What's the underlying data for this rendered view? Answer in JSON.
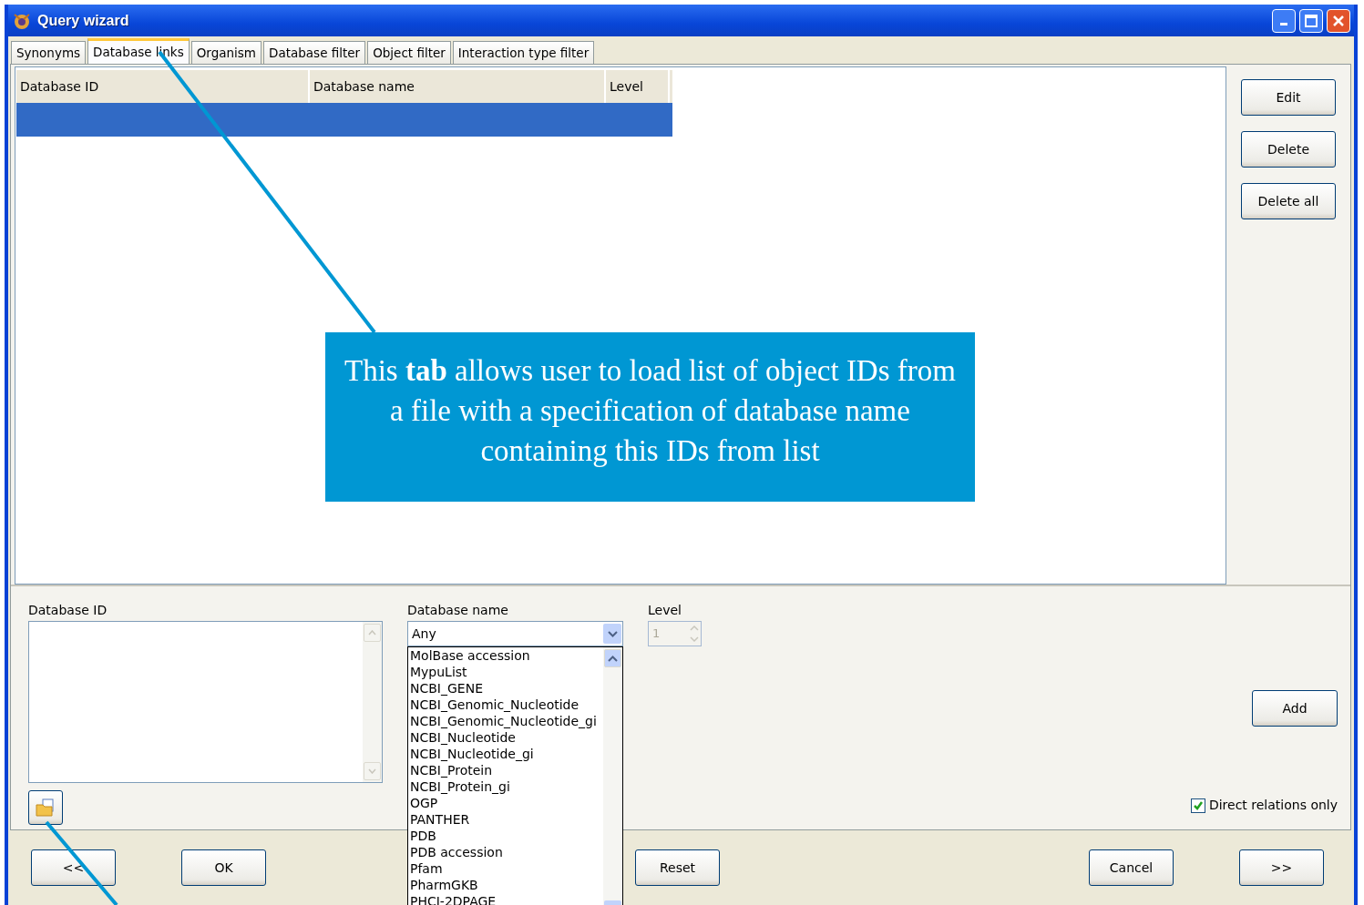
{
  "window": {
    "title": "Query wizard"
  },
  "tabs": [
    {
      "label": "Synonyms",
      "selected": false
    },
    {
      "label": "Database links",
      "selected": true
    },
    {
      "label": "Organism",
      "selected": false
    },
    {
      "label": "Database filter",
      "selected": false
    },
    {
      "label": "Object filter",
      "selected": false
    },
    {
      "label": "Interaction type filter",
      "selected": false
    }
  ],
  "table": {
    "columns": [
      "Database ID",
      "Database name",
      "Level"
    ],
    "rows": [
      {
        "selected": true
      }
    ]
  },
  "side_buttons": [
    "Edit",
    "Delete",
    "Delete all"
  ],
  "form": {
    "database_id": {
      "label": "Database ID"
    },
    "database_name": {
      "label": "Database name",
      "value": "Any",
      "expanded": true,
      "options": [
        "MolBase accession",
        "MypuList",
        "NCBI_GENE",
        "NCBI_Genomic_Nucleotide",
        "NCBI_Genomic_Nucleotide_gi",
        "NCBI_Nucleotide",
        "NCBI_Nucleotide_gi",
        "NCBI_Protein",
        "NCBI_Protein_gi",
        "OGP",
        "PANTHER",
        "PDB",
        "PDB accession",
        "Pfam",
        "PharmGKB",
        "PHCI-2DPAGE"
      ]
    },
    "level": {
      "label": "Level",
      "value": "1",
      "disabled": true
    },
    "add_button": "Add",
    "direct_relations": {
      "label": "Direct relations only",
      "checked": true
    }
  },
  "footer_buttons": [
    "<<",
    "OK",
    "Reset",
    "Cancel",
    ">>"
  ],
  "callout": {
    "text": "This **tab** allows user to load list of object IDs from a file with a specification of database name containing this IDs from list"
  }
}
